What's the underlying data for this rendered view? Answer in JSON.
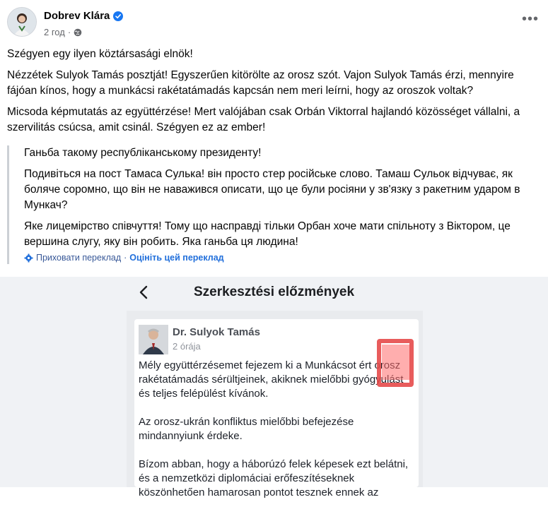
{
  "post": {
    "author": "Dobrev Klára",
    "time": "2 год",
    "more_label": "•••",
    "paragraphs": [
      "Szégyen egy ilyen köztársasági elnök!",
      "Nézzétek Sulyok Tamás posztját! Egyszerűen kitörölte az orosz szót. Vajon Sulyok Tamás érzi, mennyire fájóan kínos, hogy a munkácsi rakétatámadás kapcsán nem meri leírni, hogy az oroszok voltak?",
      "Micsoda képmutatás az együttérzése! Mert valójában csak Orbán Viktorral hajlandó közösséget vállalni, a szervilitás csúcsa, amit csinál. Szégyen ez az ember!"
    ]
  },
  "translation": {
    "paragraphs": [
      "Ганьба такому республіканському президенту!",
      "Подивіться на пост Тамаса Сулька! він просто стер російське слово. Тамаш Сульок відчуває, як боляче соромно, що він не наважився описати, що це були росіяни у зв'язку з ракетним ударом в Мункач?",
      "Яке лицемірство співчуття! Тому що насправді тільки Орбан хоче мати спільноту з Віктором, це вершина слугу, яку він робить. Яка ганьба ця людина!"
    ],
    "hide_label": "Приховати переклад",
    "separator": "·",
    "rate_label": "Оцініть цей переклад"
  },
  "screenshot": {
    "title": "Szerkesztési előzmények",
    "card": {
      "name": "Dr. Sulyok Tamás",
      "time": "2 órája",
      "paragraphs": [
        "Mély együttérzésemet fejezem ki a Munkácsot ért orosz rakétatámadás sérültjeinek, akiknek mielőbbi gyógyulást és teljes felépülést kívánok.",
        "Az orosz-ukrán konfliktus mielőbbi befejezése mindannyiunk érdeke.",
        "Bízom abban, hogy a háborúzó felek képesek ezt belátni, és a nemzetközi diplomáciai erőfeszítéseknek köszönhetően hamarosan pontot tesznek ennek az"
      ]
    }
  },
  "colors": {
    "verified": "#1877f2",
    "link": "#385898",
    "highlight": "#e64a4a"
  }
}
